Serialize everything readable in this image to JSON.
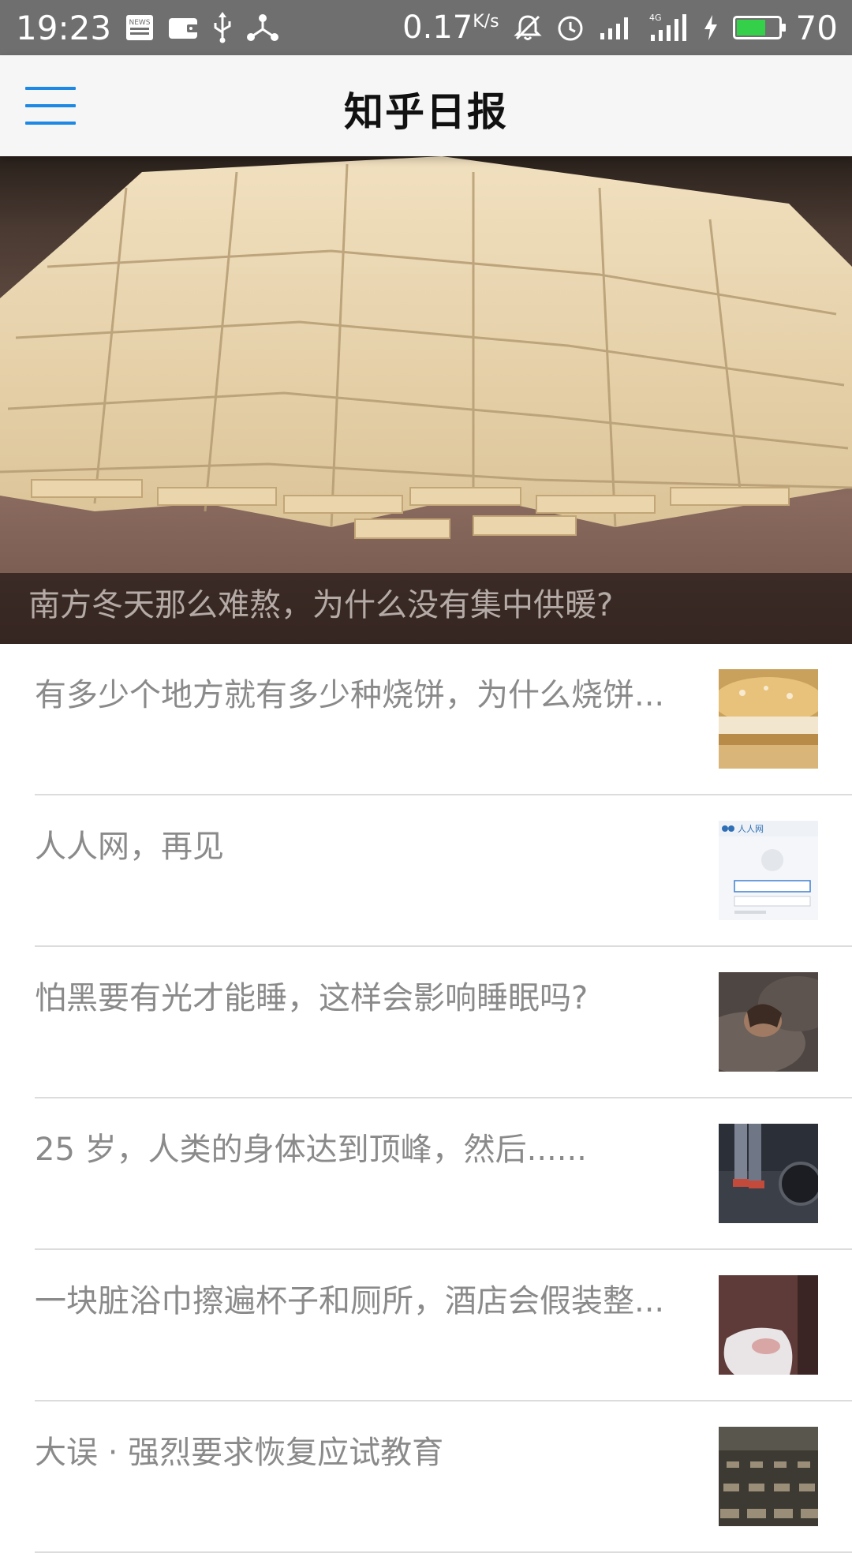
{
  "status_bar": {
    "time": "19:23",
    "net_speed": "0.17",
    "net_speed_unit": "K/s",
    "battery_level": "70",
    "battery_fraction": 0.7,
    "icons": [
      "news-icon",
      "wallet-icon",
      "usb-icon",
      "hotspot-icon",
      "mute-icon",
      "alarm-icon",
      "signal-icon",
      "signal-4g-icon",
      "charging-icon",
      "battery-icon"
    ]
  },
  "app_bar": {
    "title": "知乎日报",
    "menu_icon": "hamburger-menu-icon",
    "accent_color": "#1e88e5"
  },
  "hero": {
    "caption": "南方冬天那么难熬，为什么没有集中供暖?"
  },
  "stories": [
    {
      "title": "有多少个地方就有多少种烧饼，为什么烧饼...",
      "thumb": "flatbread-photo"
    },
    {
      "title": "人人网，再见",
      "thumb": "renren-login-screenshot",
      "thumb_logo_text": "人人网"
    },
    {
      "title": "怕黑要有光才能睡，这样会影响睡眠吗?",
      "thumb": "sleeping-person-photo"
    },
    {
      "title": "25 岁，人类的身体达到顶峰，然后......",
      "thumb": "weightlifting-photo"
    },
    {
      "title": "一块脏浴巾擦遍杯子和厕所，酒店会假装整...",
      "thumb": "hotel-towel-photo"
    },
    {
      "title": "大误 · 强烈要求恢复应试教育",
      "thumb": "exam-hall-photo"
    }
  ]
}
